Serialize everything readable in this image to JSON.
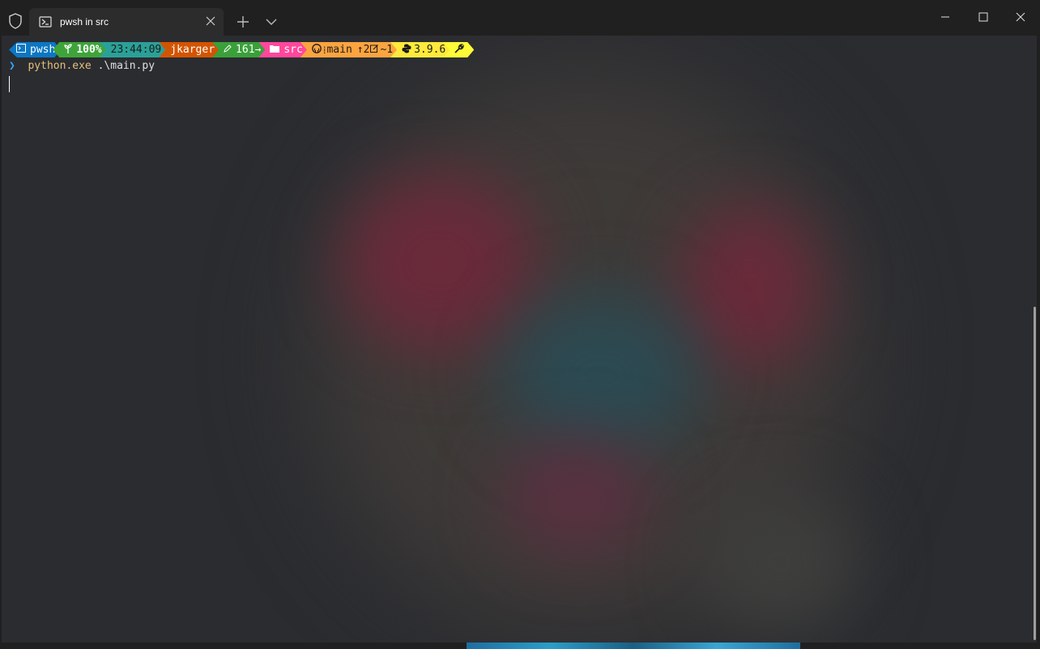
{
  "window": {
    "tab": {
      "title": "pwsh in src",
      "icon": "powershell-icon"
    },
    "controls": [
      "minimize-icon",
      "maximize-icon",
      "close-icon"
    ]
  },
  "prompt": {
    "segments": [
      {
        "id": "shell",
        "text": "pwsh",
        "icon": "terminal-icon",
        "color": "#0b77c4"
      },
      {
        "id": "battery",
        "text": "100%",
        "icon": "seedling-icon",
        "color": "#3ea43a"
      },
      {
        "id": "time",
        "text": "23:44:09",
        "color": "#2aa198"
      },
      {
        "id": "user",
        "text": "jkarger",
        "color": "#d35400"
      },
      {
        "id": "exec",
        "text": "161→",
        "icon": "pencil-icon",
        "color": "#3aa03a"
      },
      {
        "id": "path",
        "text": "src",
        "icon": "folder-icon",
        "color": "#ff479c"
      },
      {
        "id": "git",
        "branch": "main",
        "ahead": "↑2",
        "modified": "~1",
        "icon": "github-icon",
        "color": "#fca43f"
      },
      {
        "id": "python",
        "text": "3.9.6",
        "icon": "python-icon",
        "color": "#ffea3b"
      },
      {
        "id": "tool",
        "icon": "wrench-icon",
        "color": "#fffb38"
      }
    ]
  },
  "command": {
    "chevron": "❯",
    "executable": "python.exe",
    "args": " .\\main.py"
  }
}
